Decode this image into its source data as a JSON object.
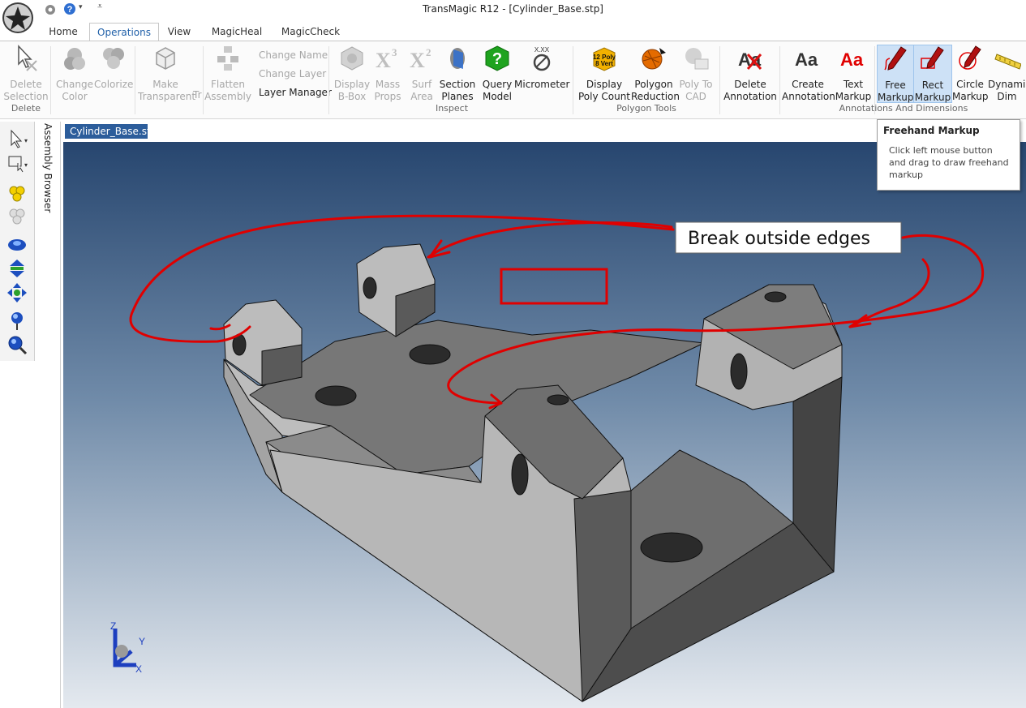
{
  "window": {
    "title": "TransMagic R12 - [Cylinder_Base.stp]"
  },
  "tabs": [
    {
      "label": "Home"
    },
    {
      "label": "Operations",
      "active": true
    },
    {
      "label": "View"
    },
    {
      "label": "MagicHeal"
    },
    {
      "label": "MagicCheck"
    }
  ],
  "ribbon": {
    "delete_selection": "Delete Selection",
    "group_delete": "Delete",
    "change_color": "Change Color",
    "colorize": "Colorize",
    "make_transparent": "Make Transparent",
    "transparent_cut": "Tr",
    "flatten_assembly": "Flatten Assembly",
    "change_name": "Change Name",
    "change_layer": "Change Layer",
    "layer_manager": "Layer Manager",
    "display_bbox": "Display B-Box",
    "mass_props": "Mass Props",
    "surf_area": "Surf Area",
    "section_planes": "Section Planes",
    "query_model": "Query Model",
    "micrometer": "Micrometer",
    "group_inspect": "Inspect",
    "display_poly_count": "Display Poly Count",
    "poly_count_icon_l1": "12 Poly",
    "poly_count_icon_l2": "8 Vert",
    "polygon_reduction": "Polygon Reduction",
    "poly_to_cad": "Poly To CAD",
    "group_polygon_tools": "Polygon Tools",
    "delete_annotation": "Delete Annotation",
    "create_annotation": "Create Annotation",
    "text_markup": "Text Markup",
    "free_markup": "Free Markup",
    "rect_markup": "Rect Markup",
    "circle_markup": "Circle Markup",
    "dynamic_dim": "Dynamic Dim",
    "group_annotations": "Annotations And Dimensions",
    "micrometer_icon_text": "X.XX",
    "aa_glyph": "Aa"
  },
  "left_panel": {
    "assembly_browser": "Assembly Browser"
  },
  "document": {
    "tab_label": "Cylinder_Base.stp"
  },
  "viewport": {
    "annotation_text": "Break outside edges",
    "axis_z": "Z",
    "axis_y": "Y",
    "axis_x": "X",
    "colors": {
      "markup": "#e00000",
      "bg_top": "#27466f",
      "bg_bottom": "#e4e9ef"
    }
  },
  "tooltip": {
    "title": "Freehand Markup",
    "body": "Click left mouse button and drag to draw freehand markup"
  }
}
